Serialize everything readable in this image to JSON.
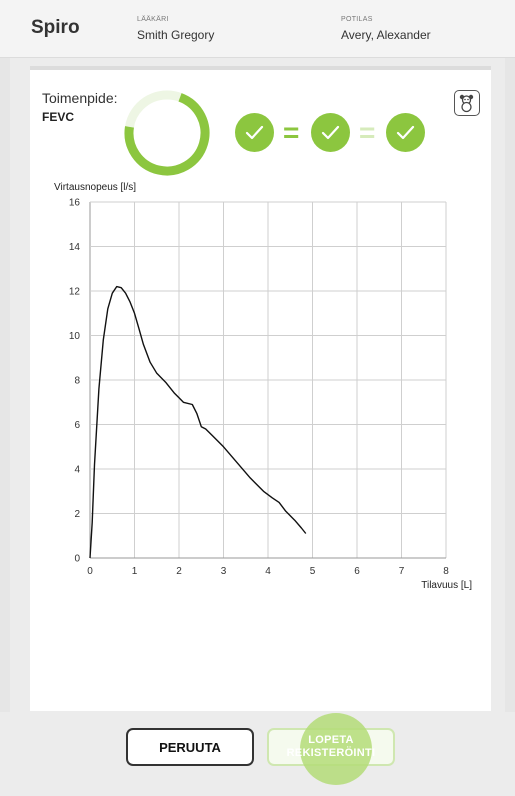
{
  "header": {
    "app_title": "Spiro",
    "doctor_caption": "LÄÄKÄRI",
    "doctor_name": "Smith Gregory",
    "patient_caption": "POTILAS",
    "patient_name": "Avery, Alexander"
  },
  "procedure": {
    "caption": "Toimenpide:",
    "value": "FEVC",
    "progress_fraction": 0.72,
    "result_sequence": [
      {
        "icon": "check-icon"
      },
      {
        "separator": "="
      },
      {
        "icon": "check-icon"
      },
      {
        "separator": "="
      },
      {
        "icon": "check-icon"
      }
    ],
    "mascot_icon": "teddy-bear-icon"
  },
  "colors": {
    "accent_green": "#8cc63f",
    "light_green": "#d6ebbb",
    "grid": "#cfcfcf",
    "curve": "#111111"
  },
  "chart_data": {
    "type": "line",
    "title": "",
    "ylabel": "Virtausnopeus [l/s]",
    "xlabel": "Tilavuus [L]",
    "xlim": [
      0,
      8
    ],
    "ylim": [
      0,
      16
    ],
    "x_ticks": [
      "0",
      "1",
      "2",
      "3",
      "4",
      "5",
      "6",
      "7",
      "8"
    ],
    "y_ticks": [
      "0",
      "2",
      "4",
      "6",
      "8",
      "10",
      "12",
      "14",
      "16"
    ],
    "grid": true,
    "series": [
      {
        "x": [
          0,
          0.05,
          0.1,
          0.2,
          0.3,
          0.4,
          0.5,
          0.6,
          0.7,
          0.8,
          0.9,
          1.0,
          1.1,
          1.2,
          1.35,
          1.5,
          1.7,
          1.9,
          2.0,
          2.1,
          2.3,
          2.4,
          2.5,
          2.6,
          2.75,
          3.0,
          3.3,
          3.6,
          3.9,
          4.1,
          4.25,
          4.4,
          4.6,
          4.75,
          4.85
        ],
        "y": [
          0,
          1.6,
          4.2,
          7.6,
          9.8,
          11.2,
          11.9,
          12.2,
          12.15,
          11.9,
          11.5,
          11.0,
          10.3,
          9.6,
          8.8,
          8.3,
          7.9,
          7.4,
          7.2,
          7.0,
          6.9,
          6.5,
          5.9,
          5.8,
          5.5,
          5.0,
          4.3,
          3.6,
          3.0,
          2.7,
          2.5,
          2.1,
          1.7,
          1.35,
          1.1
        ]
      }
    ]
  },
  "buttons": {
    "cancel_label": "PERUUTA",
    "end_label_line1": "LOPETA",
    "end_label_line2": "REKISTERÖINTI"
  }
}
